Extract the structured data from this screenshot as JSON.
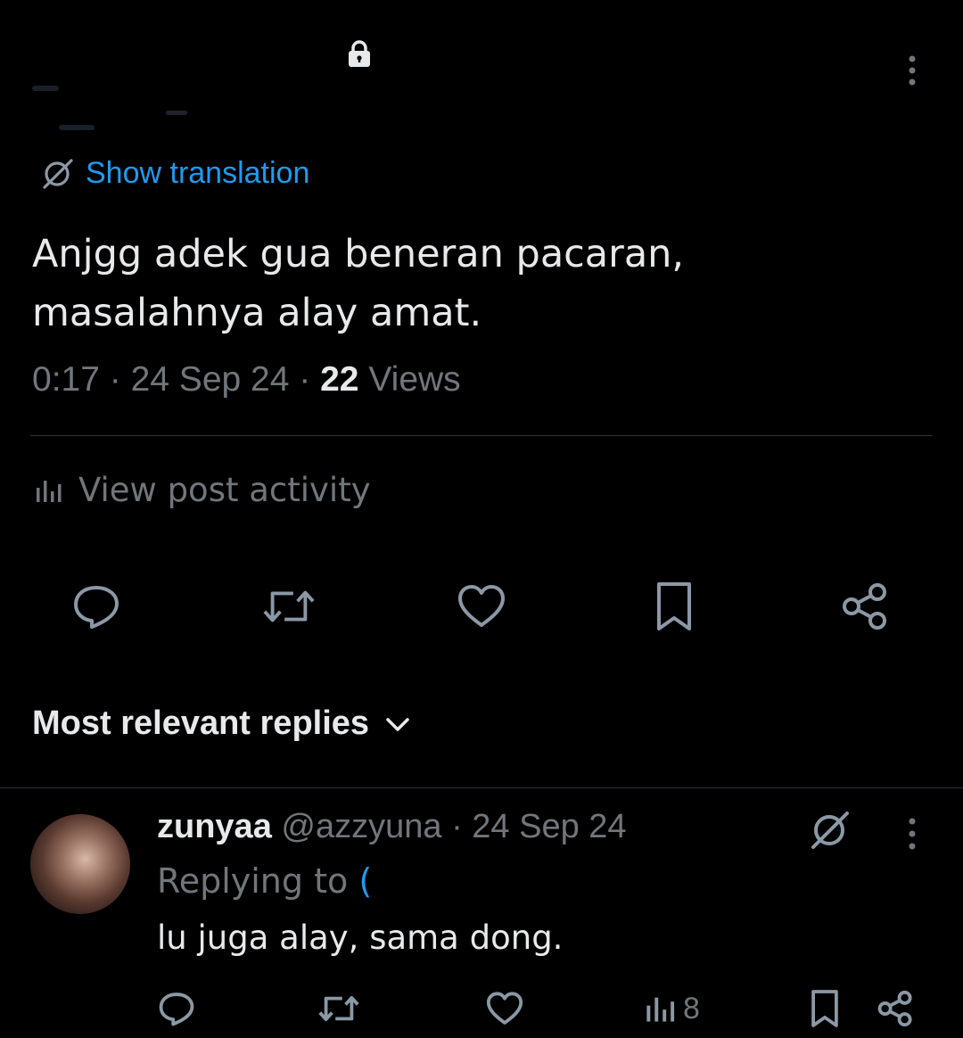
{
  "post": {
    "show_translation_label": "Show translation",
    "text_line1": "Anjgg adek gua beneran pacaran,",
    "text_line2": "masalahnya alay amat.",
    "time": "0:17",
    "date": "24 Sep 24",
    "views_count": "22",
    "views_label": "Views",
    "separator": "·",
    "view_activity_label": "View post activity"
  },
  "actions": [
    "reply-icon",
    "repost-icon",
    "like-icon",
    "bookmark-icon",
    "share-icon"
  ],
  "replies_section": {
    "sort_label": "Most relevant replies"
  },
  "reply": {
    "display_name": "zunyaa",
    "handle": "@azzyuna",
    "separator": "·",
    "date": "24 Sep 24",
    "replying_to_label": "Replying to",
    "replying_to_mention": "(",
    "text": "lu juga alay, sama dong.",
    "views_count": "8"
  },
  "colors": {
    "background": "#000000",
    "primary_text": "#e7e9ea",
    "secondary_text": "#71767b",
    "accent": "#1d9bf0",
    "divider": "#2f3336"
  }
}
